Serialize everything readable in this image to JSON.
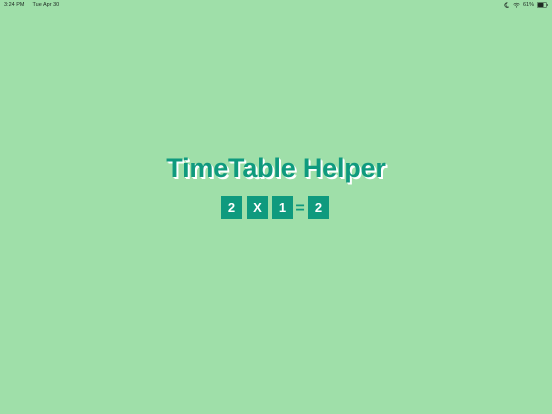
{
  "status_bar": {
    "time": "3:24 PM",
    "date": "Tue Apr 30",
    "battery_percent": "61%",
    "icons": [
      "moon-icon",
      "wifi-icon",
      "battery-icon"
    ]
  },
  "app": {
    "title": "TimeTable Helper",
    "equation": {
      "left_operand": "2",
      "operator": "X",
      "right_operand": "1",
      "equals": "=",
      "result": "2"
    }
  },
  "colors": {
    "background": "#9fdfa9",
    "accent": "#0f9a7e",
    "tile_text": "#ffffff"
  }
}
